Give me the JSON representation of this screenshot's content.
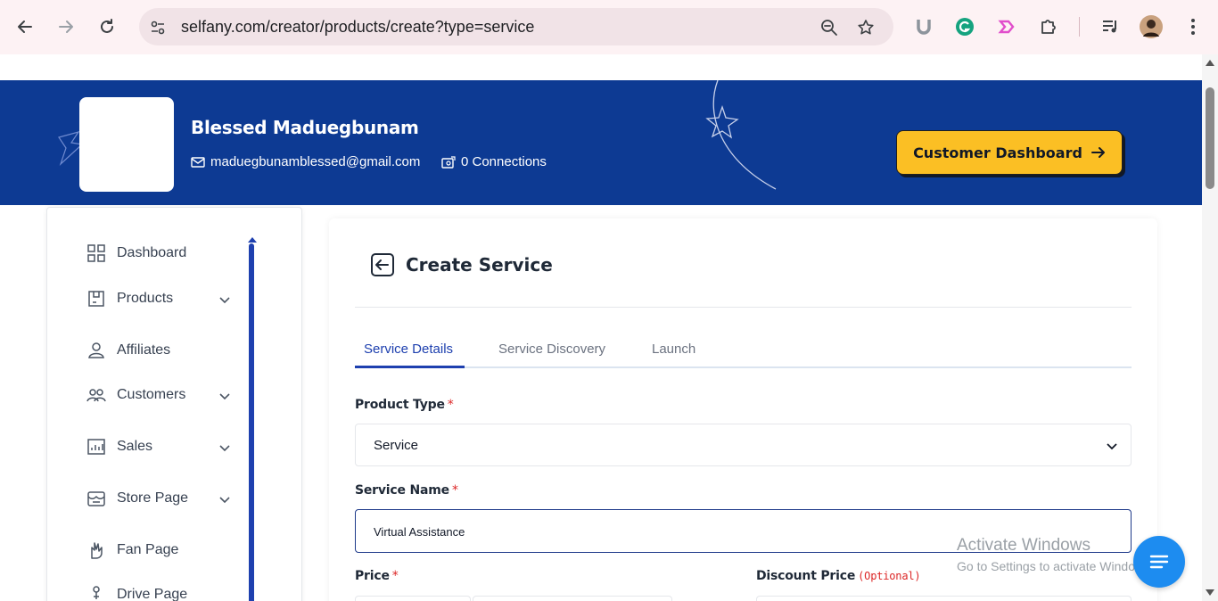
{
  "browser": {
    "url": "selfany.com/creator/products/create?type=service"
  },
  "profile": {
    "name": "Blessed Maduegbunam",
    "email": "maduegbunamblessed@gmail.com",
    "connections": "0 Connections",
    "dashboard_button": "Customer Dashboard"
  },
  "sidebar": {
    "items": [
      {
        "label": "Dashboard",
        "icon": "grid-icon",
        "has_chevron": false
      },
      {
        "label": "Products",
        "icon": "box-icon",
        "has_chevron": true
      },
      {
        "label": "Affiliates",
        "icon": "affiliates-icon",
        "has_chevron": false
      },
      {
        "label": "Customers",
        "icon": "users-icon",
        "has_chevron": true
      },
      {
        "label": "Sales",
        "icon": "chart-icon",
        "has_chevron": true
      },
      {
        "label": "Store Page",
        "icon": "store-icon",
        "has_chevron": true
      },
      {
        "label": "Fan Page",
        "icon": "hand-icon",
        "has_chevron": false
      },
      {
        "label": "Drive Page",
        "icon": "drive-icon",
        "has_chevron": false
      }
    ]
  },
  "main": {
    "title": "Create Service",
    "tabs": [
      {
        "label": "Service Details",
        "active": true
      },
      {
        "label": "Service Discovery",
        "active": false
      },
      {
        "label": "Launch",
        "active": false
      }
    ],
    "product_type": {
      "label": "Product Type",
      "required": "*",
      "value": "Service"
    },
    "service_name": {
      "label": "Service Name",
      "required": "*",
      "value": "Virtual Assistance"
    },
    "price": {
      "label": "Price",
      "required": "*"
    },
    "discount_price": {
      "label": "Discount Price",
      "optional": "(Optional)"
    }
  },
  "watermark": {
    "line1": "Activate Windows",
    "line2": "Go to Settings to activate Windows."
  },
  "colors": {
    "banner": "#0d3a93",
    "accent": "#1e40af",
    "button": "#fbbf24"
  }
}
